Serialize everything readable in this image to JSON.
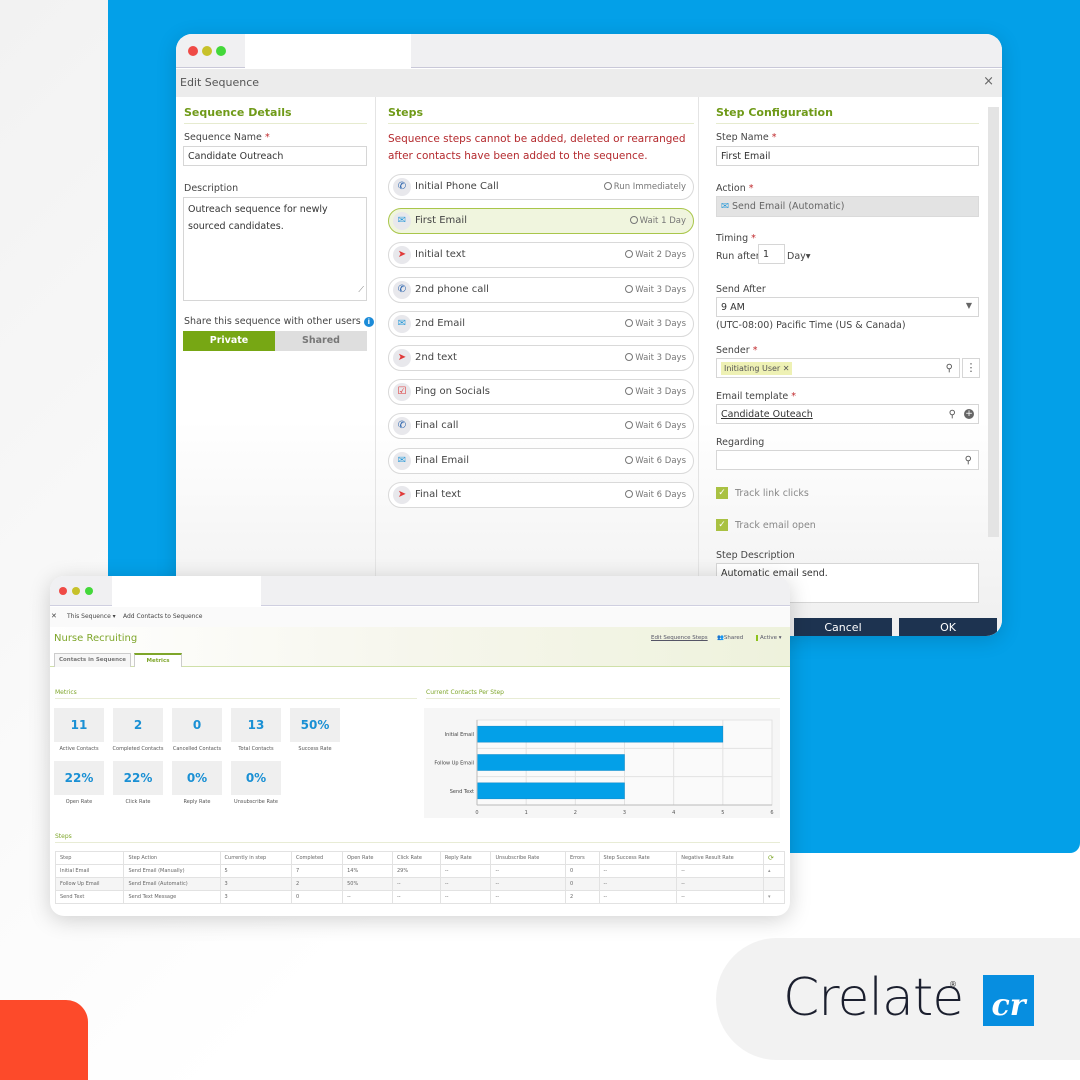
{
  "colors": {
    "brand_blue": "#03a0e8",
    "accent_green": "#77a714",
    "warning_red": "#b42a2e",
    "dark_button": "#1d3350",
    "orange": "#fd4a2a",
    "bar_blue": "#03a0e8"
  },
  "edit_dialog": {
    "title": "Edit Sequence",
    "close_icon": "×",
    "sequence_details": {
      "heading": "Sequence Details",
      "name_label": "Sequence Name",
      "name_value": "Candidate Outreach",
      "description_label": "Description",
      "description_value": "Outreach sequence for newly sourced candidates.",
      "share_label": "Share this sequence with other users",
      "share_options": [
        "Private",
        "Shared"
      ],
      "share_selected": "Private"
    },
    "steps": {
      "heading": "Steps",
      "warning": "Sequence steps cannot be added, deleted or rearranged after contacts have been added to the sequence.",
      "items": [
        {
          "name": "Initial Phone Call",
          "icon": "phone-icon",
          "timing": "Run Immediately"
        },
        {
          "name": "First Email",
          "icon": "email-icon",
          "timing": "Wait 1 Day",
          "selected": true
        },
        {
          "name": "Initial text",
          "icon": "paper-plane-icon",
          "timing": "Wait 2 Days"
        },
        {
          "name": "2nd phone call",
          "icon": "phone-icon",
          "timing": "Wait 3 Days"
        },
        {
          "name": "2nd Email",
          "icon": "email-icon",
          "timing": "Wait 3 Days"
        },
        {
          "name": "2nd text",
          "icon": "paper-plane-icon",
          "timing": "Wait 3 Days"
        },
        {
          "name": "Ping on Socials",
          "icon": "calendar-check-icon",
          "timing": "Wait 3 Days"
        },
        {
          "name": "Final call",
          "icon": "phone-icon",
          "timing": "Wait 6 Days"
        },
        {
          "name": "Final Email",
          "icon": "email-icon",
          "timing": "Wait 6 Days"
        },
        {
          "name": "Final text",
          "icon": "paper-plane-icon",
          "timing": "Wait 6 Days"
        }
      ]
    },
    "step_config": {
      "heading": "Step Configuration",
      "step_name_label": "Step Name",
      "step_name_value": "First Email",
      "action_label": "Action",
      "action_value": "Send Email (Automatic)",
      "timing_label": "Timing",
      "run_after_label": "Run after",
      "run_after_value": "1",
      "run_after_unit": "Day",
      "send_after_label": "Send After",
      "send_after_value": "9 AM",
      "timezone": "(UTC-08:00) Pacific Time (US & Canada)",
      "sender_label": "Sender",
      "sender_chip": "Initiating User",
      "email_template_label": "Email template",
      "email_template_value": "Candidate Outeach",
      "regarding_label": "Regarding",
      "regarding_value": "",
      "track_link_clicks_label": "Track link clicks",
      "track_link_clicks": true,
      "track_email_open_label": "Track email open",
      "track_email_open": true,
      "step_description_label": "Step Description",
      "step_description_value": "Automatic email send."
    },
    "buttons": {
      "cancel": "Cancel",
      "ok": "OK"
    }
  },
  "metrics_window": {
    "toolbar": {
      "close": "✕",
      "this_sequence": "This Sequence ▾",
      "add_contacts": "Add Contacts to Sequence"
    },
    "title": "Nurse Recruiting",
    "tabs": [
      {
        "label": "Contacts in Sequence"
      },
      {
        "label": "Metrics",
        "active": true
      }
    ],
    "header_links": {
      "edit_steps": "Edit Sequence Steps",
      "shared": "Shared",
      "status": "Active ▾"
    },
    "metrics_heading": "Metrics",
    "metric_tiles": [
      {
        "value": "11",
        "label": "Active Contacts"
      },
      {
        "value": "2",
        "label": "Completed Contacts"
      },
      {
        "value": "0",
        "label": "Cancelled Contacts"
      },
      {
        "value": "13",
        "label": "Total Contacts"
      },
      {
        "value": "50%",
        "label": "Success Rate"
      },
      {
        "value": "22%",
        "label": "Open Rate"
      },
      {
        "value": "22%",
        "label": "Click Rate"
      },
      {
        "value": "0%",
        "label": "Reply Rate"
      },
      {
        "value": "0%",
        "label": "Unsubscribe Rate"
      }
    ],
    "steps_heading": "Steps",
    "steps_table": {
      "columns": [
        "Step",
        "Step Action",
        "Currently in step",
        "Completed",
        "Open Rate",
        "Click Rate",
        "Reply Rate",
        "Unsubscribe Rate",
        "Errors",
        "Step Success Rate",
        "Negative Result Rate"
      ],
      "rows": [
        [
          "Initial Email",
          "Send Email (Manually)",
          "5",
          "7",
          "14%",
          "29%",
          "--",
          "--",
          "0",
          "--",
          "--"
        ],
        [
          "Follow Up Email",
          "Send Email (Automatic)",
          "3",
          "2",
          "50%",
          "--",
          "--",
          "--",
          "0",
          "--",
          "--"
        ],
        [
          "Send Text",
          "Send Text Message",
          "3",
          "0",
          "--",
          "--",
          "--",
          "--",
          "2",
          "--",
          "--"
        ]
      ]
    }
  },
  "chart_data": {
    "type": "bar",
    "orientation": "horizontal",
    "title": "Current Contacts Per Step",
    "categories": [
      "Initial Email",
      "Follow Up Email",
      "Send Text"
    ],
    "values": [
      5,
      3,
      3
    ],
    "xlabel": "",
    "ylabel": "",
    "xlim": [
      0,
      6
    ],
    "xticks": [
      "0",
      "1",
      "2",
      "3",
      "4",
      "5",
      "6"
    ],
    "grid": true,
    "legend": "none"
  },
  "branding": {
    "logo_text": "Crelate",
    "registered": "®",
    "logo_mark": "cr"
  }
}
